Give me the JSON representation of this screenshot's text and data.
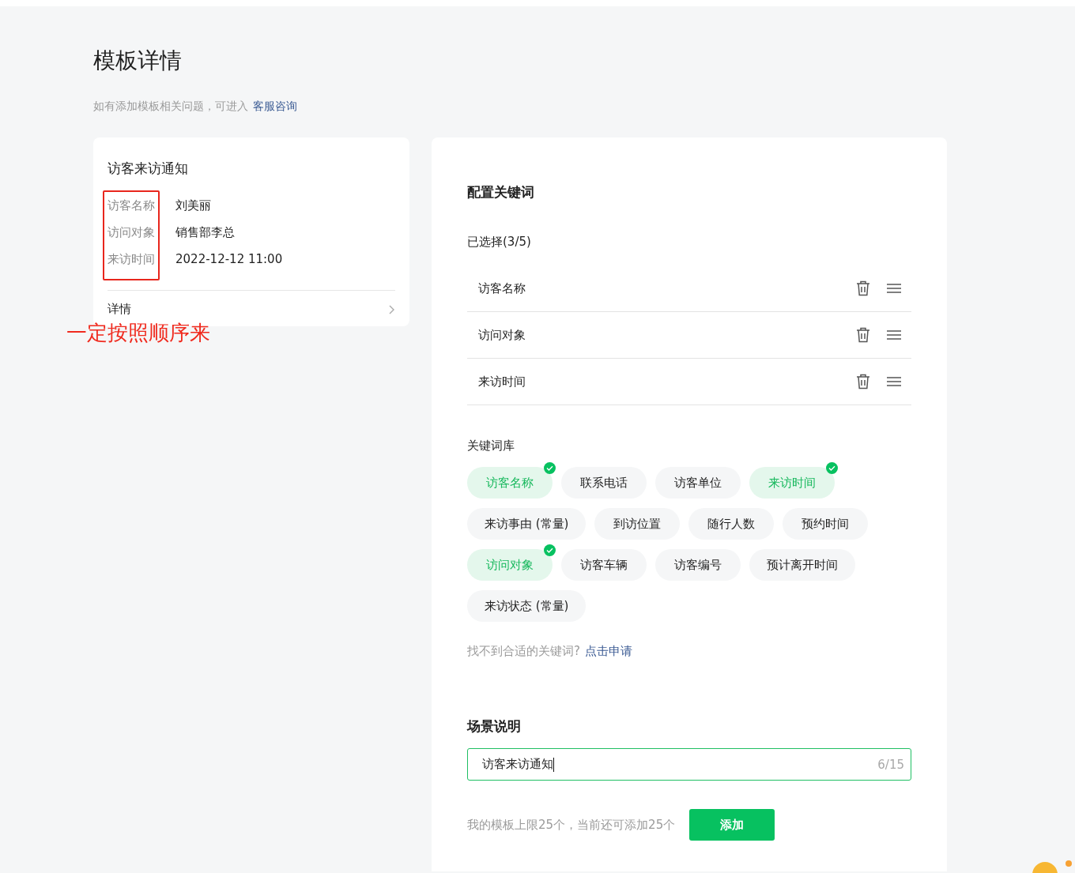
{
  "page": {
    "title": "模板详情",
    "hint": "如有添加模板相关问题，可进入",
    "hint_link": "客服咨询"
  },
  "preview": {
    "title": "访客来访通知",
    "fields": [
      {
        "label": "访客名称",
        "value": "刘美丽"
      },
      {
        "label": "访问对象",
        "value": "销售部李总"
      },
      {
        "label": "来访时间",
        "value": "2022-12-12 11:00"
      }
    ],
    "details": "详情",
    "annotation": "一定按照顺序来"
  },
  "config": {
    "title": "配置关键词",
    "selected_title": "已选择(3/5)",
    "selected": [
      "访客名称",
      "访问对象",
      "来访时间"
    ],
    "library_title": "关键词库",
    "keywords": [
      {
        "label": "访客名称",
        "selected": true
      },
      {
        "label": "联系电话",
        "selected": false
      },
      {
        "label": "访客单位",
        "selected": false
      },
      {
        "label": "来访时间",
        "selected": true
      },
      {
        "label": "来访事由 (常量)",
        "selected": false
      },
      {
        "label": "到访位置",
        "selected": false
      },
      {
        "label": "随行人数",
        "selected": false
      },
      {
        "label": "预约时间",
        "selected": false
      },
      {
        "label": "访问对象",
        "selected": true
      },
      {
        "label": "访客车辆",
        "selected": false
      },
      {
        "label": "访客编号",
        "selected": false
      },
      {
        "label": "预计离开时间",
        "selected": false
      },
      {
        "label": "来访状态 (常量)",
        "selected": false
      }
    ],
    "missing_hint": "找不到合适的关键词?",
    "missing_link": "点击申请",
    "scene_title": "场景说明",
    "scene_value": "访客来访通知",
    "scene_count": "6/15",
    "limit_text": "我的模板上限25个，当前还可添加25个",
    "add_button": "添加"
  }
}
